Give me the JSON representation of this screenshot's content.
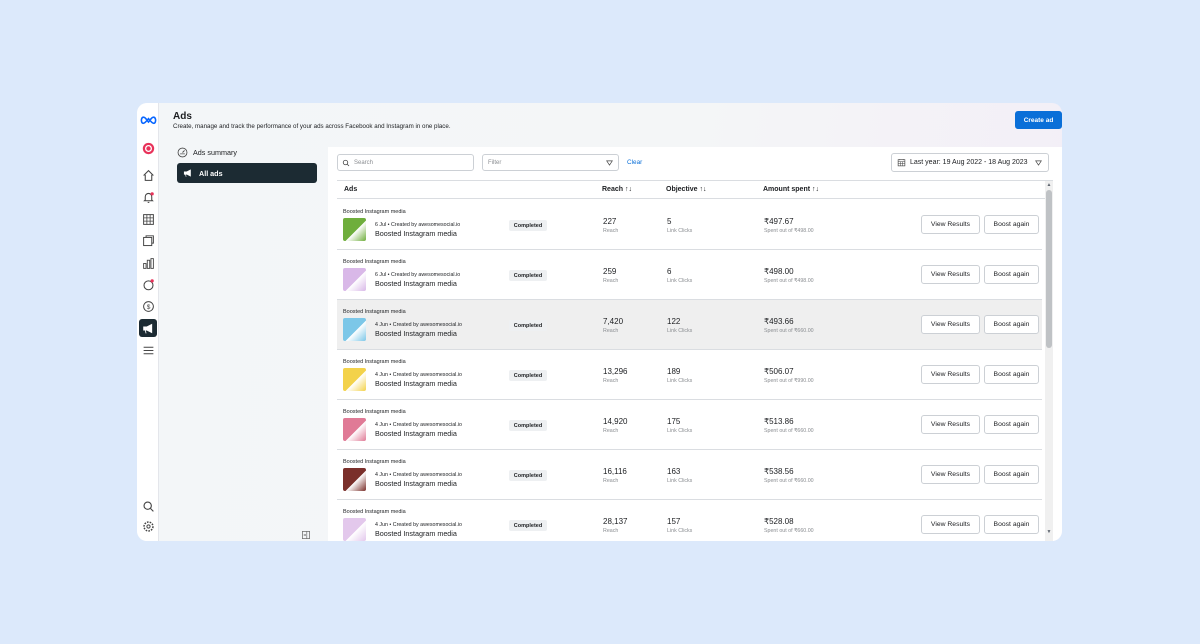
{
  "header": {
    "title": "Ads",
    "subtitle": "Create, manage and track the performance of your ads across Facebook and Instagram in one place.",
    "create_button": "Create ad"
  },
  "sidebar": {
    "items": [
      {
        "label": "Ads summary",
        "icon": "gauge-icon"
      },
      {
        "label": "All ads",
        "icon": "megaphone-icon"
      }
    ]
  },
  "rail_icons": [
    "meta-logo",
    "profile-icon",
    "home-icon",
    "notifications-icon",
    "grid-icon",
    "content-icon",
    "insights-icon",
    "inbox-icon",
    "monetization-icon",
    "ads-icon",
    "menu-icon",
    "search-icon",
    "settings-icon"
  ],
  "toolbar": {
    "search_placeholder": "Search",
    "filter_placeholder": "Filter",
    "clear_label": "Clear",
    "date_range": "Last year: 19 Aug 2022 - 18 Aug 2023"
  },
  "table": {
    "columns": [
      "Ads",
      "Reach",
      "Objective",
      "Amount spent"
    ],
    "rows": [
      {
        "group": "Boosted Instagram media",
        "meta": "6 Jul • Created by awesomesocial.io",
        "name": "Boosted Instagram media",
        "status": "Completed",
        "reach": "227",
        "reach_cap": "Reach",
        "objective": "5",
        "objective_cap": "Link Clicks",
        "amount": "₹497.67",
        "amount_cap": "Spent out of ₹498.00",
        "thumb_color": "#6fae3c",
        "view_label": "View Results",
        "boost_label": "Boost again"
      },
      {
        "group": "Boosted Instagram media",
        "meta": "6 Jul • Created by awesomesocial.io",
        "name": "Boosted Instagram media",
        "status": "Completed",
        "reach": "259",
        "reach_cap": "Reach",
        "objective": "6",
        "objective_cap": "Link Clicks",
        "amount": "₹498.00",
        "amount_cap": "Spent out of ₹498.00",
        "thumb_color": "#d9b8e8",
        "view_label": "View Results",
        "boost_label": "Boost again"
      },
      {
        "group": "Boosted Instagram media",
        "meta": "4 Jun • Created by awesomesocial.io",
        "name": "Boosted Instagram media",
        "status": "Completed",
        "reach": "7,420",
        "reach_cap": "Reach",
        "objective": "122",
        "objective_cap": "Link Clicks",
        "amount": "₹493.66",
        "amount_cap": "Spent out of ₹660.00",
        "thumb_color": "#7cc7e8",
        "view_label": "View Results",
        "boost_label": "Boost again"
      },
      {
        "group": "Boosted Instagram media",
        "meta": "4 Jun • Created by awesomesocial.io",
        "name": "Boosted Instagram media",
        "status": "Completed",
        "reach": "13,296",
        "reach_cap": "Reach",
        "objective": "189",
        "objective_cap": "Link Clicks",
        "amount": "₹506.07",
        "amount_cap": "Spent out of ₹990.00",
        "thumb_color": "#f3d24a",
        "view_label": "View Results",
        "boost_label": "Boost again"
      },
      {
        "group": "Boosted Instagram media",
        "meta": "4 Jun • Created by awesomesocial.io",
        "name": "Boosted Instagram media",
        "status": "Completed",
        "reach": "14,920",
        "reach_cap": "Reach",
        "objective": "175",
        "objective_cap": "Link Clicks",
        "amount": "₹513.86",
        "amount_cap": "Spent out of ₹660.00",
        "thumb_color": "#e07a96",
        "view_label": "View Results",
        "boost_label": "Boost again"
      },
      {
        "group": "Boosted Instagram media",
        "meta": "4 Jun • Created by awesomesocial.io",
        "name": "Boosted Instagram media",
        "status": "Completed",
        "reach": "16,116",
        "reach_cap": "Reach",
        "objective": "163",
        "objective_cap": "Link Clicks",
        "amount": "₹538.56",
        "amount_cap": "Spent out of ₹660.00",
        "thumb_color": "#7a2f2a",
        "view_label": "View Results",
        "boost_label": "Boost again"
      },
      {
        "group": "Boosted Instagram media",
        "meta": "4 Jun • Created by awesomesocial.io",
        "name": "Boosted Instagram media",
        "status": "Completed",
        "reach": "28,137",
        "reach_cap": "Reach",
        "objective": "157",
        "objective_cap": "Link Clicks",
        "amount": "₹528.08",
        "amount_cap": "Spent out of ₹660.00",
        "thumb_color": "#e3c8ec",
        "view_label": "View Results",
        "boost_label": "Boost again"
      }
    ]
  },
  "colors": {
    "accent": "#0a6fd8",
    "nav_active": "#1c2b33",
    "highlight_row": "#efefef"
  }
}
